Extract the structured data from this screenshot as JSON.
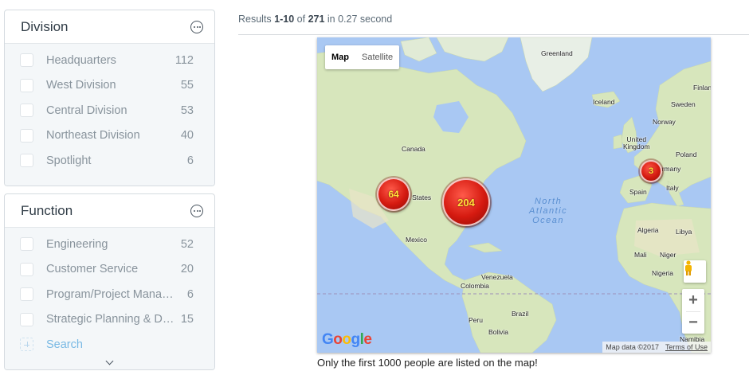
{
  "facets": [
    {
      "title": "Division",
      "items": [
        {
          "label": "Headquarters",
          "count": "112"
        },
        {
          "label": "West Division",
          "count": "55"
        },
        {
          "label": "Central Division",
          "count": "53"
        },
        {
          "label": "Northeast Division",
          "count": "40"
        },
        {
          "label": "Spotlight",
          "count": "6"
        }
      ]
    },
    {
      "title": "Function",
      "items": [
        {
          "label": "Engineering",
          "count": "52"
        },
        {
          "label": "Customer Service",
          "count": "20"
        },
        {
          "label": "Program/Project Management",
          "count": "6"
        },
        {
          "label": "Strategic Planning & Development",
          "count": "15"
        }
      ],
      "search_label": "Search"
    }
  ],
  "results": {
    "prefix": "Results ",
    "range": "1-10",
    "of_word": " of ",
    "total": "271",
    "suffix": " in 0.27 second"
  },
  "map": {
    "type_controls": {
      "map": "Map",
      "satellite": "Satellite"
    },
    "labels": {
      "greenland": "Greenland",
      "iceland": "Iceland",
      "finland": "Finlan",
      "sweden": "Sweden",
      "norway": "Norway",
      "uk": "United\nKingdom",
      "poland": "Poland",
      "germany": "ermany",
      "italy": "Italy",
      "spain": "Spain",
      "canada": "Canada",
      "us": "d States",
      "mexico": "Mexico",
      "venezuela": "Venezuela",
      "colombia": "Colombia",
      "brazil": "Brazil",
      "peru": "Peru",
      "bolivia": "Bolivia",
      "algeria": "Algeria",
      "libya": "Libya",
      "mali": "Mali",
      "niger": "Niger",
      "nigeria": "Nigeria",
      "namibia": "Namibia"
    },
    "ocean_label": "North\nAtlantic\nOcean",
    "clusters": [
      {
        "count": "64"
      },
      {
        "count": "204"
      },
      {
        "count": "3"
      }
    ],
    "zoom_in": "+",
    "zoom_out": "−",
    "logo": "Google",
    "attribution": "Map data ©2017",
    "terms": "Terms of Use",
    "colors": {
      "water": "#a9c8f3",
      "land": "#d7e6bc",
      "cluster": "#d51a10",
      "cluster_text": "#ffe23a"
    }
  },
  "caption": "Only the first 1000 people are listed on the map!"
}
